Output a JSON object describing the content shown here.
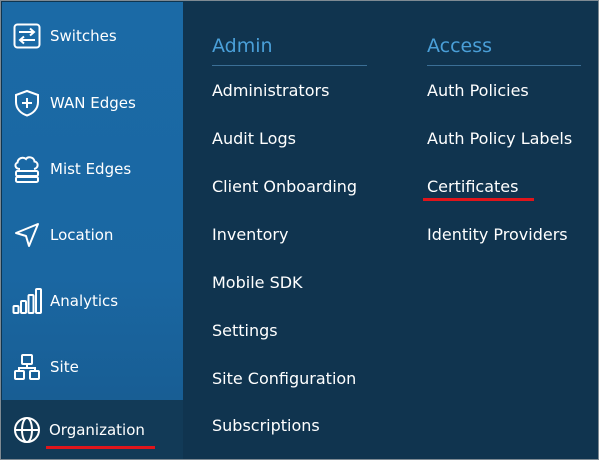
{
  "sidebar": {
    "items": [
      {
        "label": "Switches",
        "icon": "switch-arrows-icon"
      },
      {
        "label": "WAN Edges",
        "icon": "shield-plus-icon"
      },
      {
        "label": "Mist Edges",
        "icon": "cloud-server-icon"
      },
      {
        "label": "Location",
        "icon": "location-arrow-icon"
      },
      {
        "label": "Analytics",
        "icon": "bar-chart-icon"
      },
      {
        "label": "Site",
        "icon": "site-tree-icon"
      },
      {
        "label": "Organization",
        "icon": "globe-icon",
        "active": true
      }
    ]
  },
  "menu": {
    "admin": {
      "heading": "Admin",
      "links": [
        "Administrators",
        "Audit Logs",
        "Client Onboarding",
        "Inventory",
        "Mobile SDK",
        "Settings",
        "Site Configuration",
        "Subscriptions"
      ]
    },
    "access": {
      "heading": "Access",
      "links": [
        "Auth Policies",
        "Auth Policy Labels",
        "Certificates",
        "Identity Providers"
      ]
    }
  },
  "colors": {
    "sidebar": "#1b6aa6",
    "menu_bg": "#10344f",
    "heading": "#4a9fd8",
    "highlight": "#e0151b"
  }
}
